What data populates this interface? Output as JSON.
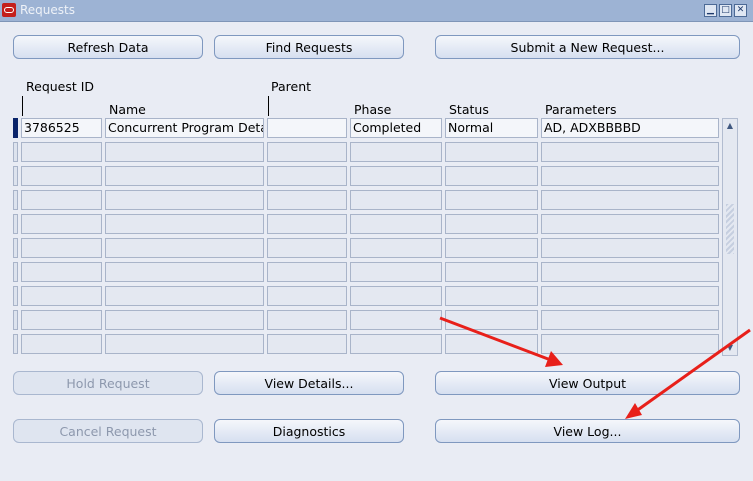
{
  "window": {
    "title": "Requests",
    "minimize": "▁",
    "maximize": "□",
    "close": "✕"
  },
  "top_buttons": {
    "refresh": "Refresh Data",
    "find": "Find Requests",
    "submit": "Submit a New Request..."
  },
  "columns": {
    "request_id": "Request ID",
    "name": "Name",
    "parent": "Parent",
    "phase": "Phase",
    "status": "Status",
    "parameters": "Parameters"
  },
  "rows": [
    {
      "request_id": "3786525",
      "name": "Concurrent Program Details",
      "parent": "",
      "phase": "Completed",
      "status": "Normal",
      "parameters": "AD, ADXBBBBD"
    }
  ],
  "bottom_buttons": {
    "hold": "Hold Request",
    "view_details": "View Details...",
    "view_output": "View Output",
    "cancel": "Cancel Request",
    "diagnostics": "Diagnostics",
    "view_log": "View Log..."
  },
  "annotation_color": "#e8201a"
}
